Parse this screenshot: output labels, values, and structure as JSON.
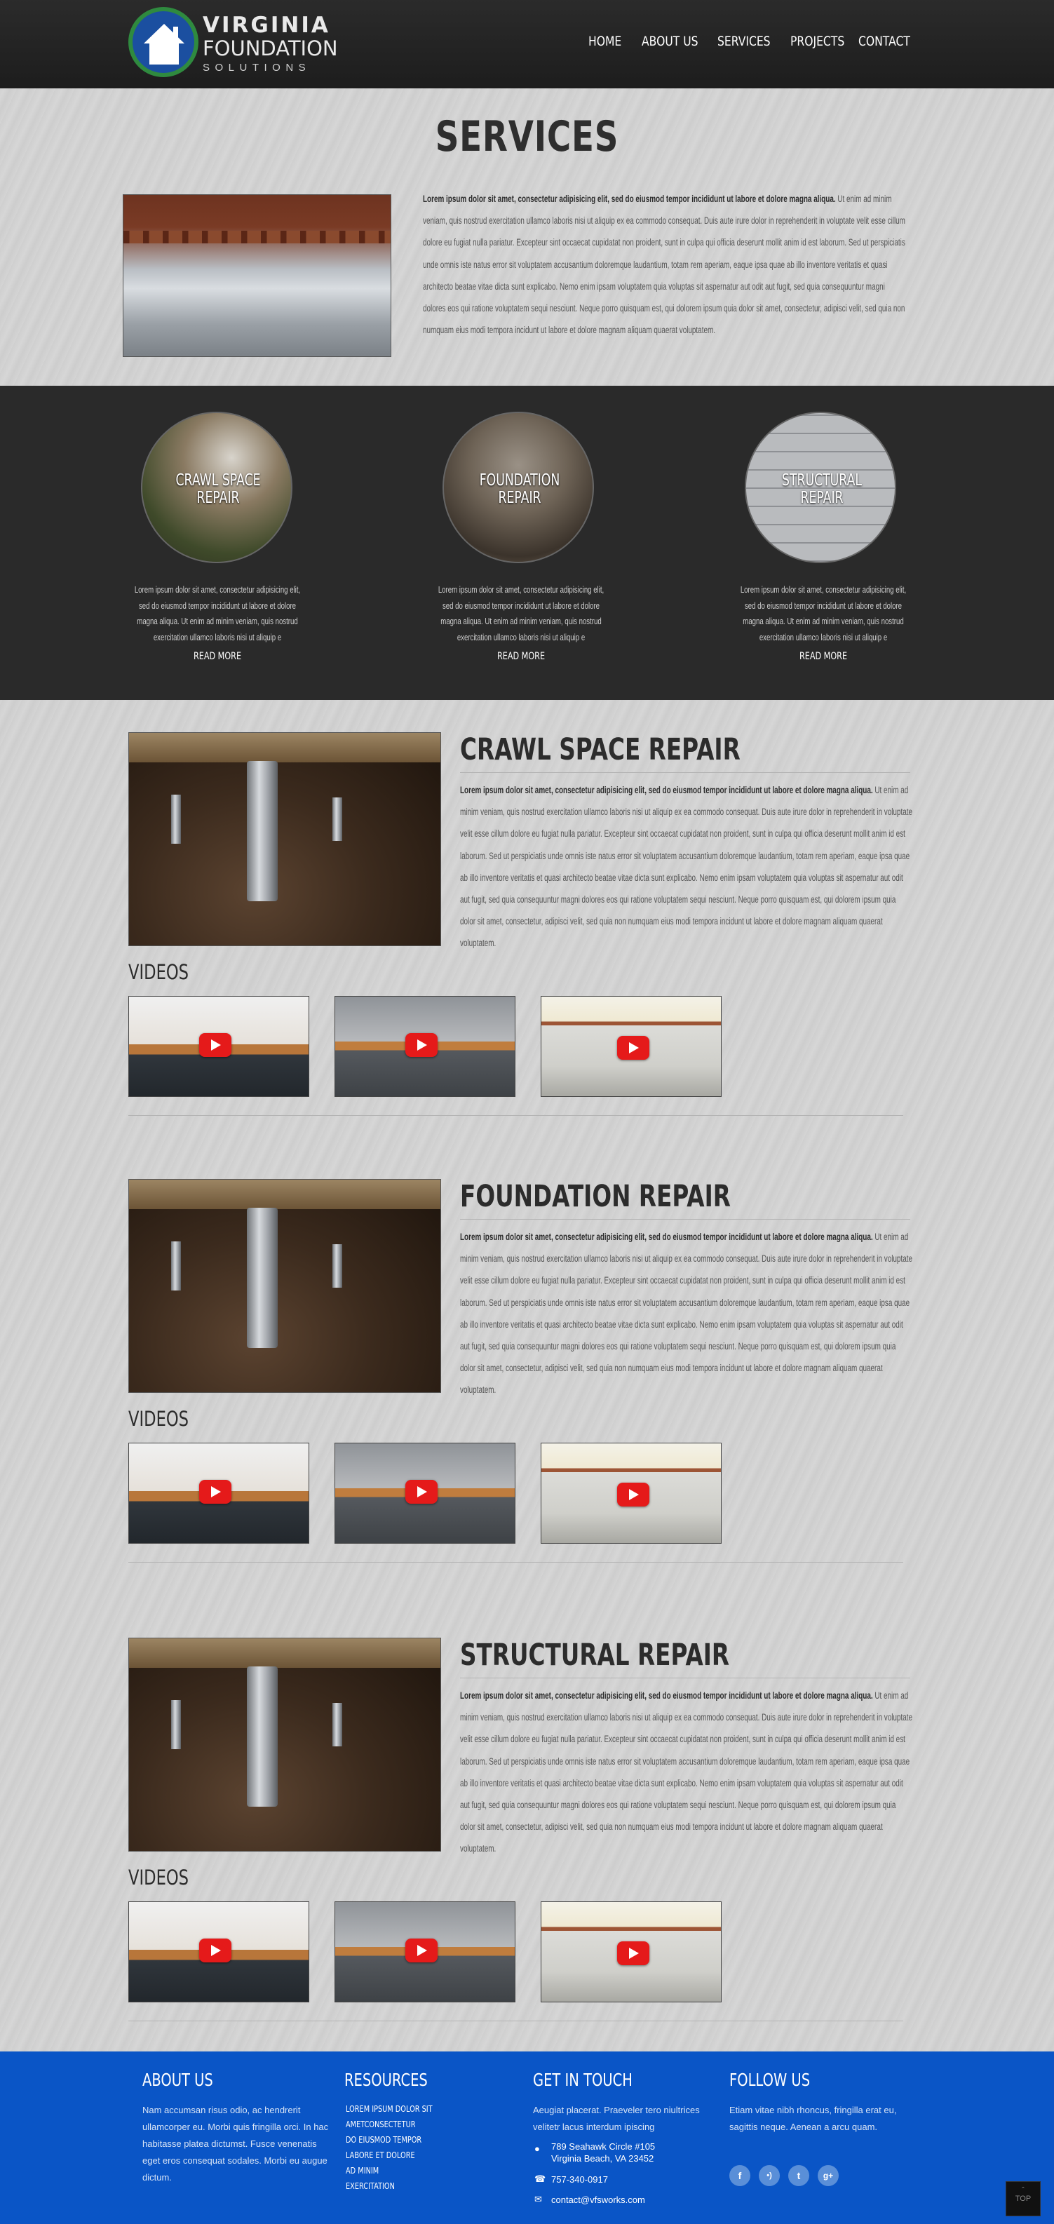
{
  "header": {
    "logo": {
      "line1": "VIRGINIA",
      "line2": "FOUNDATION",
      "line3": "SOLUTIONS"
    },
    "nav": [
      "HOME",
      "ABOUT US",
      "SERVICES",
      "PROJECTS",
      "CONTACT"
    ]
  },
  "intro": {
    "title": "SERVICES",
    "lead": "Lorem ipsum dolor sit amet, consectetur adipisicing elit, sed do eiusmod tempor incididunt ut labore et dolore magna aliqua.",
    "body": "Ut enim ad minim veniam, quis nostrud exercitation ullamco laboris nisi ut aliquip ex ea commodo consequat. Duis aute irure dolor in reprehenderit in voluptate velit esse cillum dolore eu fugiat nulla pariatur. Excepteur sint occaecat cupidatat non proident, sunt in culpa qui officia deserunt mollit anim id est laborum. Sed ut perspiciatis unde omnis iste natus error sit voluptatem accusantium doloremque laudantium, totam rem aperiam, eaque ipsa quae ab illo inventore veritatis et quasi architecto beatae vitae dicta sunt explicabo. Nemo enim ipsam voluptatem quia voluptas sit aspernatur aut odit aut fugit, sed quia consequuntur magni dolores eos qui ratione voluptatem sequi nesciunt. Neque porro quisquam est, qui dolorem ipsum quia dolor sit amet, consectetur, adipisci velit, sed quia non numquam eius modi tempora incidunt ut labore et dolore magnam aliquam quaerat voluptatem."
  },
  "band": {
    "cards": [
      {
        "label1": "CRAWL SPACE",
        "label2": "REPAIR",
        "text": "Lorem ipsum dolor sit amet, consectetur adipisicing elit, sed do eiusmod tempor incididunt ut labore et dolore magna aliqua. Ut enim ad minim veniam, quis nostrud exercitation ullamco laboris nisi ut aliquip e",
        "more": "READ MORE"
      },
      {
        "label1": "FOUNDATION",
        "label2": "REPAIR",
        "text": "Lorem ipsum dolor sit amet, consectetur adipisicing elit, sed do eiusmod tempor incididunt ut labore et dolore magna aliqua. Ut enim ad minim veniam, quis nostrud exercitation ullamco laboris nisi ut aliquip e",
        "more": "READ MORE"
      },
      {
        "label1": "STRUCTURAL",
        "label2": "REPAIR",
        "text": "Lorem ipsum dolor sit amet, consectetur adipisicing elit, sed do eiusmod tempor incididunt ut labore et dolore magna aliqua. Ut enim ad minim veniam, quis nostrud exercitation ullamco laboris nisi ut aliquip e",
        "more": "READ MORE"
      }
    ]
  },
  "sections": [
    {
      "title": "CRAWL SPACE REPAIR",
      "videos_label": "VIDEOS"
    },
    {
      "title": "FOUNDATION REPAIR",
      "videos_label": "VIDEOS"
    },
    {
      "title": "STRUCTURAL REPAIR",
      "videos_label": "VIDEOS"
    }
  ],
  "section_text": {
    "lead": "Lorem ipsum dolor sit amet, consectetur adipisicing elit, sed do eiusmod tempor incididunt ut labore et dolore magna aliqua.",
    "body": "Ut enim ad minim veniam, quis nostrud exercitation ullamco laboris nisi ut aliquip ex ea commodo consequat. Duis aute irure dolor in reprehenderit in voluptate velit esse cillum dolore eu fugiat nulla pariatur. Excepteur sint occaecat cupidatat non proident, sunt in culpa qui officia deserunt mollit anim id est laborum. Sed ut perspiciatis unde omnis iste natus error sit voluptatem accusantium doloremque laudantium, totam rem aperiam, eaque ipsa quae ab illo inventore veritatis et quasi architecto beatae vitae dicta sunt explicabo. Nemo enim ipsam voluptatem quia voluptas sit aspernatur aut odit aut fugit, sed quia consequuntur magni dolores eos qui ratione voluptatem sequi nesciunt. Neque porro quisquam est, qui dolorem ipsum quia dolor sit amet, consectetur, adipisci velit, sed quia non numquam eius modi tempora incidunt ut labore et dolore magnam aliquam quaerat voluptatem."
  },
  "footer": {
    "about": {
      "title": "ABOUT US",
      "text": "Nam accumsan risus odio, ac hendrerit ullamcorper eu. Morbi quis fringilla orci. In hac habitasse platea dictumst. Fusce venenatis eget eros consequat sodales. Morbi eu augue dictum."
    },
    "resources": {
      "title": "RESOURCES",
      "links": [
        "LOREM IPSUM DOLOR SIT",
        "AMETCONSECTETUR",
        "DO EIUSMOD TEMPOR",
        "LABORE ET DOLORE",
        "AD MINIM",
        "EXERCITATION"
      ]
    },
    "contact": {
      "title": "GET IN TOUCH",
      "text": "Aeugiat placerat. Praeveler tero niultrices velitetr lacus interdum ipiscing",
      "address1": "789 Seahawk Circle #105",
      "address2": "Virginia Beach, VA 23452",
      "phone": "757-340-0917",
      "email": "contact@vfsworks.com"
    },
    "follow": {
      "title": "FOLLOW US",
      "text": "Etiam vitae nibh rhoncus, fringilla erat eu, sagittis neque. Aenean a arcu quam.",
      "icons": [
        "f",
        "rss",
        "t",
        "g+"
      ]
    },
    "top": "TOP"
  },
  "colors": {
    "header": "#222222",
    "band": "#2a2a2a",
    "footer": "#0a55c6",
    "background": "#d2d2d2",
    "play": "#e51a1a"
  }
}
